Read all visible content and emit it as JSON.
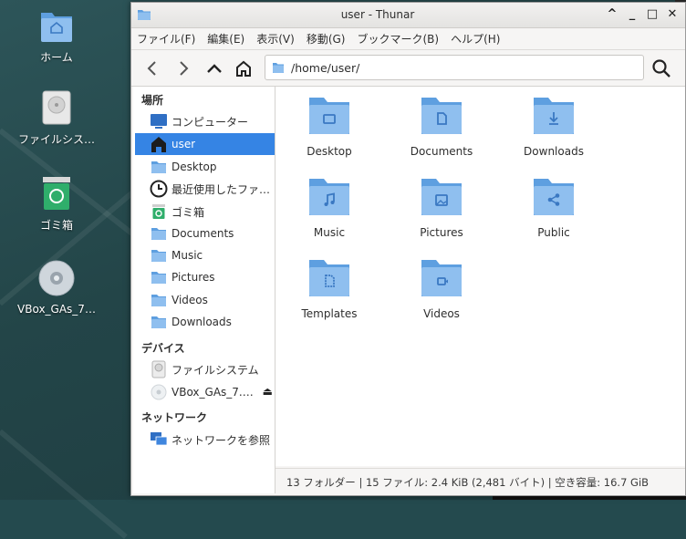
{
  "desktop": {
    "icons": [
      {
        "label": "ホーム",
        "icon": "home-folder-icon"
      },
      {
        "label": "ファイルシス…",
        "icon": "drive-icon"
      },
      {
        "label": "ゴミ箱",
        "icon": "trash-icon"
      },
      {
        "label": "VBox_GAs_7…",
        "icon": "optical-disc-icon"
      }
    ]
  },
  "window": {
    "title": "user - Thunar",
    "controls": {
      "shade": "^",
      "minimize": "_",
      "maximize": "□",
      "close": "✕"
    }
  },
  "menubar": {
    "items": [
      "ファイル(F)",
      "編集(E)",
      "表示(V)",
      "移動(G)",
      "ブックマーク(B)",
      "ヘルプ(H)"
    ]
  },
  "toolbar": {
    "location": "/home/user/"
  },
  "sidebar": {
    "places_heading": "場所",
    "places": [
      {
        "label": "コンピューター",
        "icon": "computer-icon"
      },
      {
        "label": "user",
        "icon": "home-icon",
        "active": true
      },
      {
        "label": "Desktop",
        "icon": "folder-icon"
      },
      {
        "label": "最近使用したファ…",
        "icon": "clock-icon"
      },
      {
        "label": "ゴミ箱",
        "icon": "trash-icon"
      },
      {
        "label": "Documents",
        "icon": "folder-icon"
      },
      {
        "label": "Music",
        "icon": "folder-icon"
      },
      {
        "label": "Pictures",
        "icon": "folder-icon"
      },
      {
        "label": "Videos",
        "icon": "folder-icon"
      },
      {
        "label": "Downloads",
        "icon": "folder-icon"
      }
    ],
    "devices_heading": "デバイス",
    "devices": [
      {
        "label": "ファイルシステム",
        "icon": "drive-icon"
      },
      {
        "label": "VBox_GAs_7.1.…",
        "icon": "optical-disc-icon"
      }
    ],
    "network_heading": "ネットワーク",
    "network": [
      {
        "label": "ネットワークを参照",
        "icon": "network-icon"
      }
    ]
  },
  "files": [
    {
      "name": "Desktop",
      "icon": "desktop-folder-icon"
    },
    {
      "name": "Documents",
      "icon": "documents-folder-icon"
    },
    {
      "name": "Downloads",
      "icon": "downloads-folder-icon"
    },
    {
      "name": "Music",
      "icon": "music-folder-icon"
    },
    {
      "name": "Pictures",
      "icon": "pictures-folder-icon"
    },
    {
      "name": "Public",
      "icon": "public-folder-icon"
    },
    {
      "name": "Templates",
      "icon": "templates-folder-icon"
    },
    {
      "name": "Videos",
      "icon": "videos-folder-icon"
    }
  ],
  "statusbar": {
    "text": "13 フォルダー | 15 ファイル: 2.4 KiB (2,481 バイト) | 空き容量: 16.7 GiB"
  },
  "colors": {
    "accent": "#3584e4",
    "folder": "#8fbfef",
    "folder_dark": "#5e9fe0"
  }
}
